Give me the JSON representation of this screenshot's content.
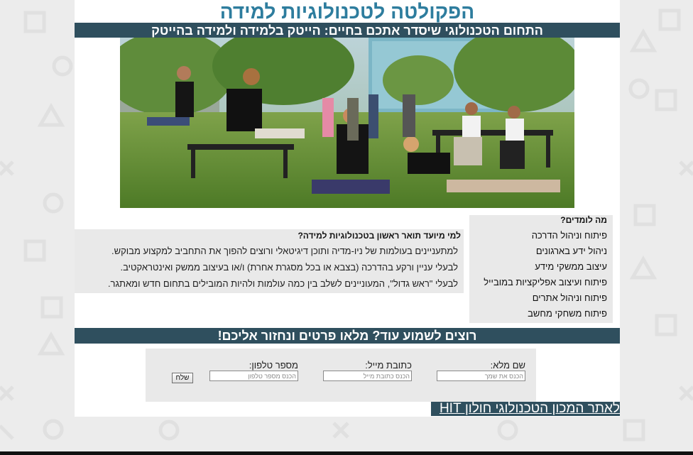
{
  "header": {
    "title": "הפקולטה לטכנולוגיות למידה",
    "tagline": "התחום הטכנולוגי שיסדר אתכם בחיים: הייטק בלמידה ולמידה בהייטק"
  },
  "hero": {
    "image": "students-sitting-on-campus-lawn-photo"
  },
  "studies": {
    "heading": "מה לומדים?",
    "items": [
      "פיתוח וניהול הדרכה",
      "ניהול ידע בארגונים",
      "עיצוב ממשקי מידע",
      "פיתוח ועיצוב אפליקציות במובייל",
      "פיתוח וניהול אתרים",
      "פיתוח משחקי מחשב"
    ]
  },
  "audience": {
    "heading": "למי מיועד תואר ראשון בטכנולוגיות למידה?",
    "items": [
      "למתעניינים בעולמות של ניו-מדיה ותוכן דיגיטאלי ורוצים להפוך את התחביב למקצוע מבוקש.",
      "לבעלי עניין ורקע בהדרכה (בצבא או בכל מסגרת אחרת) ו/או בעיצוב ממשק ואינטראקטיב.",
      "לבעלי \"ראש גדול\", המעוניינים לשלב בין כמה עולמות ולהיות המובילים בתחום חדש ומאתגר."
    ]
  },
  "contact": {
    "heading": "רוצים לשמוע עוד? מלאו פרטים ונחזור אליכם!",
    "name_label": "שם מלא:",
    "name_placeholder": "הכנס את שמך",
    "email_label": "כתובת מייל:",
    "email_placeholder": "הכנס כתובת מייל",
    "phone_label": "מספר טלפון:",
    "phone_placeholder": "הכנס מספר טלפון",
    "send_label": "שלח"
  },
  "footer": {
    "link_label": "לאתר המכון הטכנולוגי חולון HIT"
  },
  "colors": {
    "title": "#2e7d9e",
    "banner": "#2f4f5e",
    "box": "#e9e9e9",
    "background": "#ececec"
  }
}
